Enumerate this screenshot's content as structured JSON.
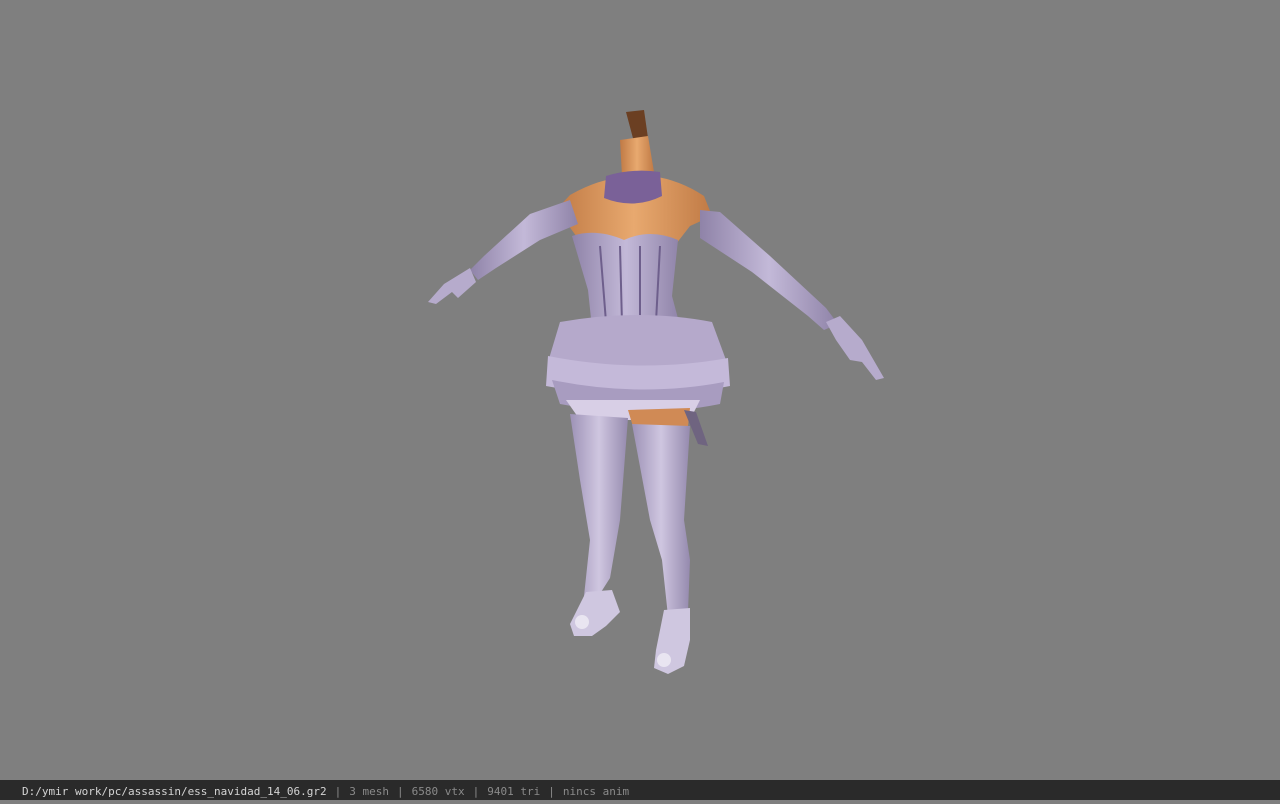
{
  "status_bar": {
    "file_path": "D:/ymir work/pc/assassin/ess_navidad_14_06.gr2",
    "separator": "|",
    "mesh_count": "3 mesh",
    "vertex_count": "6580 vtx",
    "triangle_count": "9401 tri",
    "anim_status": "nincs anim"
  },
  "colors": {
    "background": "#7f7f7f",
    "status_bar": "#2a2a2a",
    "outfit": "#b9aed0",
    "outfit_shadow": "#8c7fa6",
    "skin": "#d9975f",
    "choker": "#7a6198"
  }
}
